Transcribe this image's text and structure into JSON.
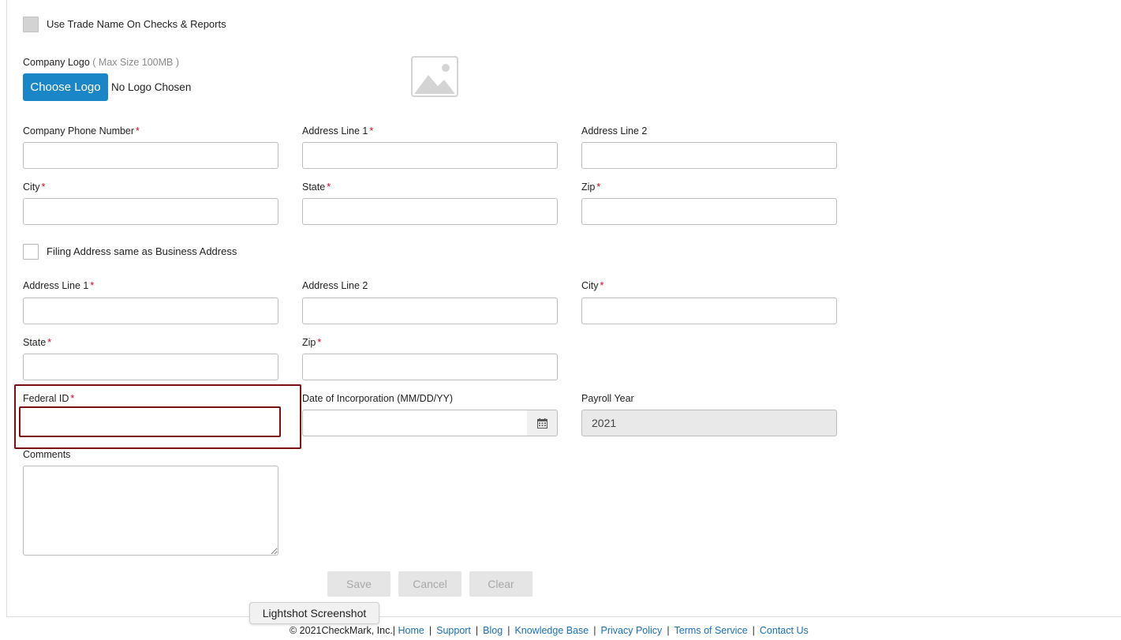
{
  "options": {
    "trade_name_label": "Use Trade Name On Checks & Reports",
    "filing_same_label": "Filing Address same as Business Address"
  },
  "logo": {
    "label": "Company Logo",
    "hint": "( Max Size 100MB )",
    "button_label": "Choose Logo",
    "status_text": "No Logo Chosen",
    "placeholder_icon": "image-icon"
  },
  "business_address": {
    "phone_label": "Company Phone Number",
    "address1_label": "Address Line 1",
    "address2_label": "Address Line 2",
    "city_label": "City",
    "state_label": "State",
    "zip_label": "Zip"
  },
  "filing_address": {
    "address1_label": "Address Line 1",
    "address2_label": "Address Line 2",
    "city_label": "City",
    "state_label": "State",
    "zip_label": "Zip"
  },
  "company_info": {
    "federal_id_label": "Federal ID",
    "incorporation_label": "Date of Incorporation (MM/DD/YY)",
    "calendar_icon": "calendar-icon",
    "payroll_year_label": "Payroll Year",
    "payroll_year_value": "2021",
    "comments_label": "Comments"
  },
  "required_marker": "*",
  "actions": {
    "save_label": "Save",
    "cancel_label": "Cancel",
    "clear_label": "Clear"
  },
  "tooltip": "Lightshot Screenshot",
  "footer": {
    "copyright": "© 2021CheckMark, Inc.|",
    "links": [
      "Home",
      "Support",
      "Blog",
      "Knowledge Base",
      "Privacy Policy",
      "Terms of Service",
      "Contact Us"
    ]
  },
  "colors": {
    "primary": "#1a86c7",
    "required": "#d9001b",
    "highlight": "#7a1010",
    "link": "#1a70b8"
  }
}
